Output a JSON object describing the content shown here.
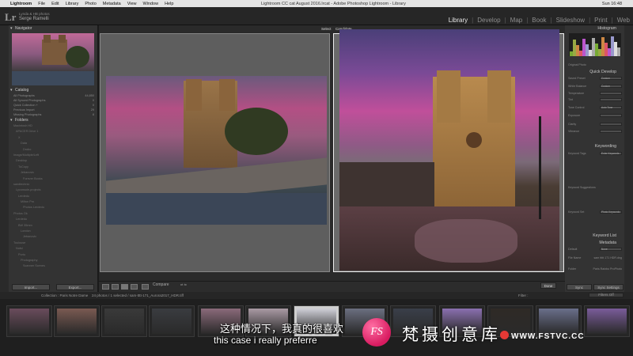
{
  "menubar": {
    "app": "Lightroom",
    "items": [
      "File",
      "Edit",
      "Library",
      "Photo",
      "Metadata",
      "View",
      "Window",
      "Help"
    ],
    "window_title": "Lightroom CC cat August 2016.lrcat - Adobe Photoshop Lightroom - Library",
    "clock": "Sun 16:48"
  },
  "identity": {
    "logo": "Lr",
    "line1": "Lynda & HB photos",
    "line2": "Serge Ramelli"
  },
  "modules": [
    "Library",
    "Develop",
    "Map",
    "Book",
    "Slideshow",
    "Print",
    "Web"
  ],
  "active_module": "Library",
  "left_panel": {
    "navigator": "Navigator",
    "catalog": "Catalog",
    "catalog_items": [
      {
        "label": "All Photographs",
        "count": "44,850"
      },
      {
        "label": "All Synced Photographs",
        "count": "0"
      },
      {
        "label": "Quick Collection +",
        "count": "0"
      },
      {
        "label": "Previous Import",
        "count": "29"
      },
      {
        "label": "Missing Photographs",
        "count": "8"
      }
    ],
    "folders": "Folders",
    "folder_items": [
      "Macintosh HD",
      "APACER Drive 1",
      "X",
      "Data",
      "Drobo",
      "Image/Multiple/Left",
      "Desktop",
      "ToCopy",
      "Jebanovic",
      "Forever Books",
      "sandtechnic",
      "Lyconsole-projects",
      "Lerdedu",
      "Milton Pro",
      "Photos Lerdedu",
      "Photos Ok",
      "Lerdedu",
      "BW 35mm",
      "London",
      "Jebanovic",
      "Toulouse",
      "Nutsi",
      "Porto",
      "Photography",
      "Scanner Scenes"
    ],
    "import_button": "Import...",
    "export_button": "Export..."
  },
  "center": {
    "select_label": "Select",
    "candidate_label": "Candidate"
  },
  "toolbar": {
    "compare": "Compare",
    "done": "Done"
  },
  "right_panel": {
    "histogram": "Histogram",
    "original_photo": "Original Photo",
    "quick_develop": "Quick Develop",
    "saved_preset": {
      "label": "Saved Preset",
      "value": "Custom"
    },
    "white_balance": {
      "label": "White Balance",
      "value": "Custom"
    },
    "temperature": "Temperature",
    "tint": "Tint",
    "tone_control": {
      "label": "Tone Control",
      "value": "Auto Tone"
    },
    "exposure": "Exposure",
    "clarity": "Clarity",
    "vibrance": "Vibrance",
    "keywording": "Keywording",
    "keyword_tags": {
      "label": "Keyword Tags",
      "value": "Enter Keywords"
    },
    "keyword_suggestions": "Keyword Suggestions",
    "keyword_set": {
      "label": "Keyword Set",
      "value": "Photo Keywords"
    },
    "keyword_list": "Keyword List",
    "metadata": "Metadata",
    "metadata_preset": {
      "label": "Default",
      "value": "None"
    },
    "file_name": {
      "label": "File Name",
      "value": "sam ttttt 171 HDR.dng"
    },
    "folder": {
      "label": "Folder",
      "value": "Paris Rainbo ProPhoto"
    },
    "sync_button": "Sync",
    "sync_settings_button": "Sync Settings"
  },
  "filmstrip": {
    "collection": "Collection : Paris Notre Dame",
    "info": "24 photos / 1 selected / sam-tttt-171_Aurora2017_HDR.tiff",
    "filter_label": "Filter :",
    "filter_value": "Filters Off"
  },
  "overlay": {
    "subtitle_cn": "这种情况下，我真的很喜欢",
    "subtitle_en": "this case i really preferre",
    "brand": "梵摄创意库",
    "url": "WWW.FSTVC.CC",
    "logo_letters": "FS"
  }
}
